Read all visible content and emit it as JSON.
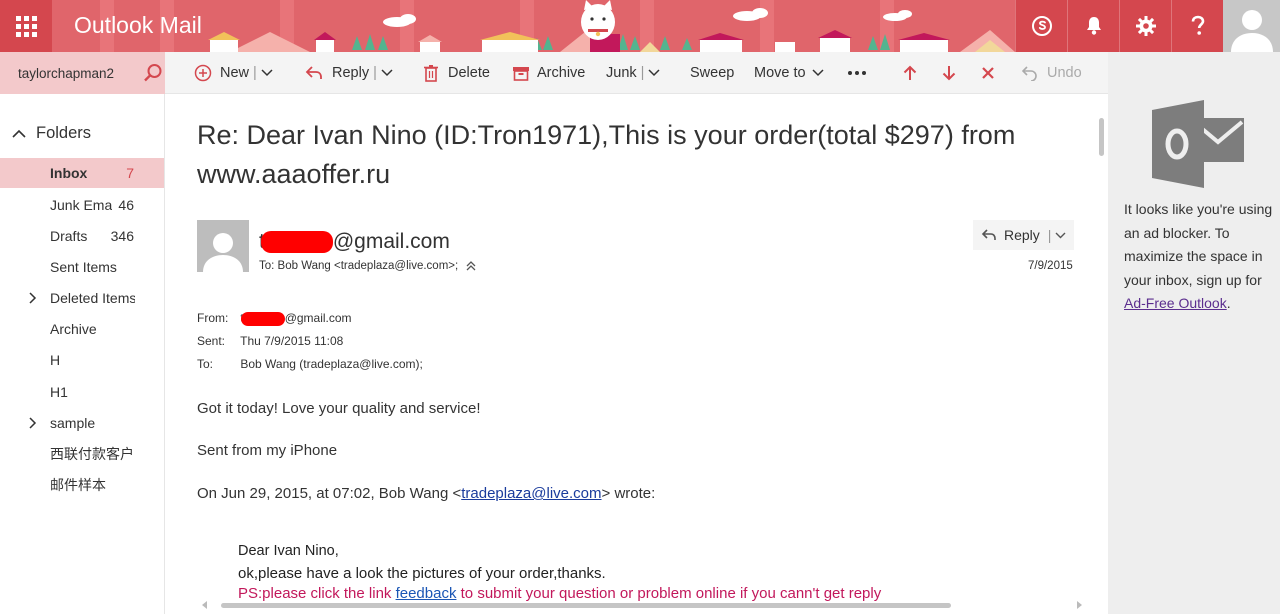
{
  "header": {
    "app_title": "Outlook Mail",
    "icons": [
      "skype-icon",
      "notifications-icon",
      "settings-icon",
      "help-icon"
    ]
  },
  "search": {
    "user": "taylorchapman2"
  },
  "toolbar": {
    "new_label": "New",
    "reply_label": "Reply",
    "delete_label": "Delete",
    "archive_label": "Archive",
    "junk_label": "Junk",
    "sweep_label": "Sweep",
    "move_to_label": "Move to",
    "undo_label": "Undo"
  },
  "nav": {
    "folders_label": "Folders",
    "items": [
      {
        "label": "Inbox",
        "count": "7"
      },
      {
        "label": "Junk Ema",
        "count": "46"
      },
      {
        "label": "Drafts",
        "count": "346"
      },
      {
        "label": "Sent Items",
        "count": ""
      },
      {
        "label": "Deleted Items",
        "count": ""
      },
      {
        "label": "Archive",
        "count": ""
      },
      {
        "label": "H",
        "count": ""
      },
      {
        "label": "H1",
        "count": ""
      },
      {
        "label": "sample",
        "count": ""
      },
      {
        "label": "西联付款客户",
        "count": ""
      },
      {
        "label": "邮件样本",
        "count": ""
      }
    ]
  },
  "message": {
    "subject": "Re: Dear Ivan Nino (ID:Tron1971),This is your order(total $297) from www.aaaoffer.ru",
    "sender_prefix": "t",
    "sender_domain": "@gmail.com",
    "to_line": "To: Bob Wang <tradeplaza@live.com>;",
    "reply_label": "Reply",
    "date": "7/9/2015",
    "headers": {
      "from_key": "From:",
      "from_prefix": "t",
      "from_domain": "@gmail.com",
      "sent_key": "Sent:",
      "sent_value": "Thu 7/9/2015 11:08",
      "to_key": "To:",
      "to_value": "Bob Wang (tradeplaza@live.com);"
    },
    "body": {
      "line1": "Got it today!  Love your quality and service!",
      "line2": "Sent from my iPhone",
      "wrote_prefix": "On Jun 29, 2015, at 07:02, Bob Wang <",
      "wrote_link": "tradeplaza@live.com",
      "wrote_suffix": "> wrote:",
      "quote_greeting": "Dear Ivan Nino,",
      "quote_line": "ok,please have a look the pictures of your order,thanks.",
      "ps_prefix": "PS:please click the link ",
      "ps_link": "feedback",
      "ps_suffix": " to submit your question or problem online if you cann't get reply"
    }
  },
  "ad": {
    "text": "It looks like you're using an ad blocker. To maximize the space in your inbox, sign up for ",
    "link": "Ad-Free Outlook",
    "suffix": "."
  },
  "colors": {
    "brand": "#d4474e",
    "banner": "#e0656b",
    "selected": "#f3c9cb",
    "toolbar_red_icons": "#d4474e",
    "link_blue": "#1a3b9c",
    "ps_text": "#c2185b"
  }
}
